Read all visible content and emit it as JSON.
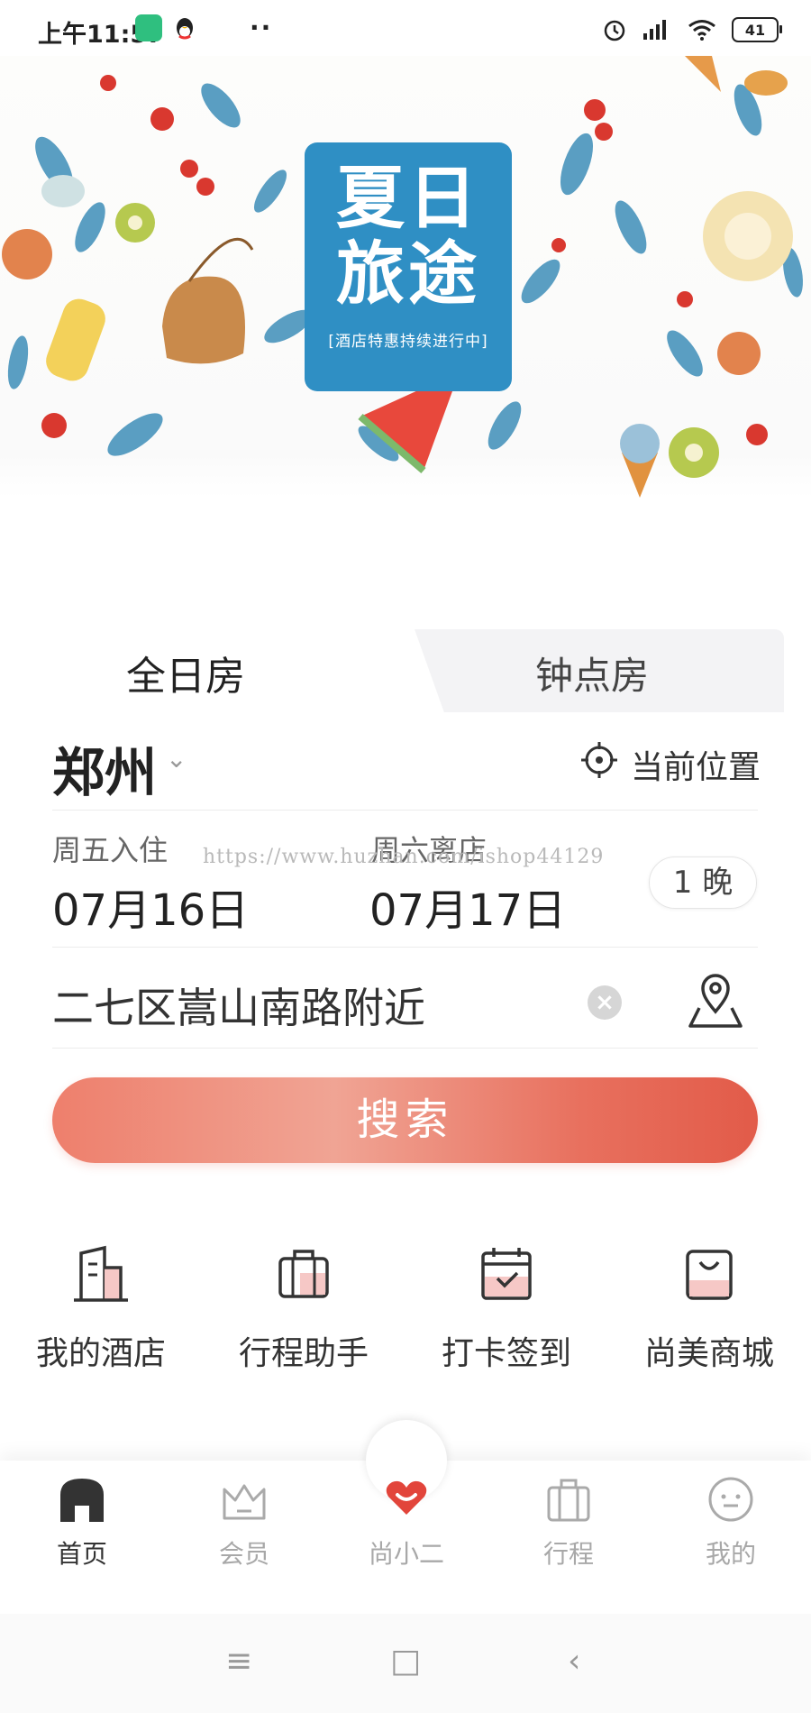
{
  "status_bar": {
    "time": "上午11:57",
    "battery": "41"
  },
  "banner": {
    "title_line1": "夏日",
    "title_line2": "旅途",
    "subtitle": "[酒店特惠持续进行中]",
    "accent_color": "#2f8fc4"
  },
  "tabs": {
    "full_day": "全日房",
    "hourly": "钟点房"
  },
  "search": {
    "city": "郑州",
    "current_location": "当前位置",
    "checkin_day": "周五入住",
    "checkin_date": "07月16日",
    "checkout_day": "周六离店",
    "checkout_date": "07月17日",
    "nights": "1 晚",
    "location_value": "二七区嵩山南路附近",
    "search_button": "搜索",
    "button_color": "#e8705e"
  },
  "watermark": "https://www.huzhan.com/ishop44129",
  "quick_links": [
    {
      "label": "我的酒店",
      "icon": "hotel-icon"
    },
    {
      "label": "行程助手",
      "icon": "suitcase-icon"
    },
    {
      "label": "打卡签到",
      "icon": "calendar-check-icon"
    },
    {
      "label": "尚美商城",
      "icon": "shopping-bag-icon"
    }
  ],
  "bottom_nav": [
    {
      "label": "首页",
      "icon": "home-icon"
    },
    {
      "label": "会员",
      "icon": "crown-icon"
    },
    {
      "label": "尚小二",
      "icon": "heart-logo-icon"
    },
    {
      "label": "行程",
      "icon": "luggage-icon"
    },
    {
      "label": "我的",
      "icon": "profile-icon"
    }
  ],
  "system_nav": {
    "menu": "≡",
    "home": "□",
    "back": "‹"
  }
}
